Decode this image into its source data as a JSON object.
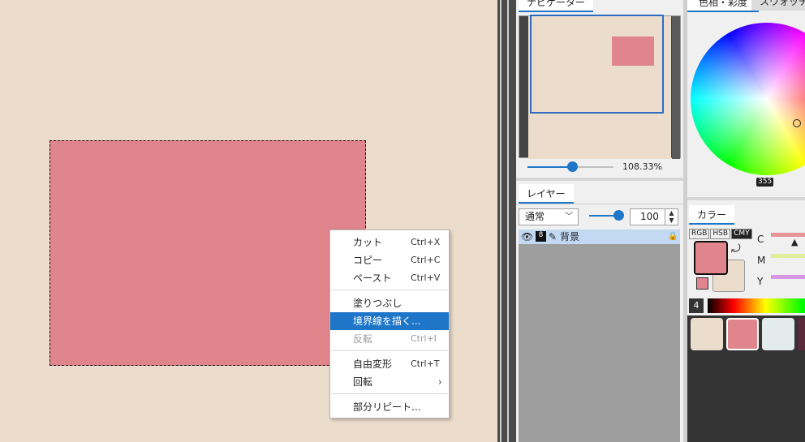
{
  "canvas": {
    "background": "#ecdccb",
    "selection_fill": "#df858b"
  },
  "context_menu": {
    "items": [
      {
        "label": "カット",
        "shortcut": "Ctrl+X"
      },
      {
        "label": "コピー",
        "shortcut": "Ctrl+C"
      },
      {
        "label": "ペースト",
        "shortcut": "Ctrl+V"
      },
      {
        "label": "塗りつぶし",
        "shortcut": ""
      },
      {
        "label": "境界線を描く...",
        "shortcut": ""
      },
      {
        "label": "反転",
        "shortcut": "Ctrl+I"
      },
      {
        "label": "自由変形",
        "shortcut": "Ctrl+T"
      },
      {
        "label": "回転",
        "shortcut": ""
      },
      {
        "label": "部分リピート...",
        "shortcut": ""
      }
    ],
    "highlighted": "境界線を描く...",
    "disabled": [
      "反転"
    ],
    "submenu_arrow": "›"
  },
  "navigator": {
    "tab": "ナビゲーター",
    "zoom": "108.33%",
    "zoom_fraction": 0.52
  },
  "layers": {
    "tab": "レイヤー",
    "blend_mode": "通常",
    "opacity": "100",
    "opacity_fraction": 1.0,
    "row": {
      "name": "背景",
      "layer_number": "8",
      "icons": [
        "eye-icon",
        "grid-icon",
        "pen-icon",
        "lock-icon"
      ]
    }
  },
  "color_wheel": {
    "tab_active": "色相・彩度",
    "tab_other": "スウォッチ",
    "hue_value": "355"
  },
  "color_panel": {
    "tab": "カラー",
    "modes": [
      "RGB",
      "HSB",
      "CMY"
    ],
    "active_mode": "CMY",
    "sliders": [
      {
        "label": "C",
        "color": "#e89597"
      },
      {
        "label": "M",
        "color": "#e0f098"
      },
      {
        "label": "Y",
        "color": "#d897e4"
      }
    ],
    "foreground": "#df858b",
    "background": "#ecdccb",
    "palette_index": "4",
    "palette": [
      "#ecdccb",
      "#df858b",
      "#e3ecea",
      "#5a2a3a"
    ]
  },
  "accent": "#1f76c8"
}
